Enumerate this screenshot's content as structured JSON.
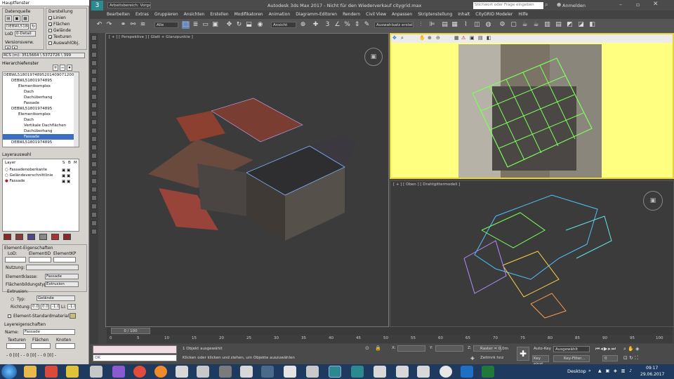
{
  "left_panel": {
    "window_title": "Hauptfenster",
    "datenquelle": {
      "label": "Datenquelle",
      "id_value": "DEBWL51801",
      "lod_label": "LoD",
      "lod_value": "0-Detail",
      "version_label": "Versionsverw."
    },
    "darstellung": {
      "label": "Darstellung",
      "items": [
        {
          "label": "Linien",
          "checked": true
        },
        {
          "label": "Flächen",
          "checked": true
        },
        {
          "label": "Gelände",
          "checked": false
        },
        {
          "label": "Texturen",
          "checked": true
        },
        {
          "label": "AuswahlObj.",
          "checked": false
        }
      ]
    },
    "rcs": "RCS (m): 3515664 \\ 5372726 \\ 399",
    "hierarchy_title": "Hierarchiefenster",
    "tree": [
      {
        "text": "DEBWL51801974895201409071200002",
        "indent": 0
      },
      {
        "text": "DEBWL51801974895",
        "indent": 1
      },
      {
        "text": "Elementkomplex",
        "indent": 2
      },
      {
        "text": "Dach",
        "indent": 3
      },
      {
        "text": "Dachüberhang",
        "indent": 3
      },
      {
        "text": "Fassade",
        "indent": 3
      },
      {
        "text": "DEBWL51801974895",
        "indent": 1
      },
      {
        "text": "Elementkomplex",
        "indent": 2
      },
      {
        "text": "Dach",
        "indent": 3
      },
      {
        "text": "Vertikale Dachflächen",
        "indent": 3
      },
      {
        "text": "Dachüberhang",
        "indent": 3
      },
      {
        "text": "Fassade",
        "indent": 3
      },
      {
        "text": "DEBWL51801974895",
        "indent": 1
      }
    ],
    "layer_title": "Layerauswahl",
    "layer_header": {
      "layer": "Layer",
      "s": "S",
      "b": "B",
      "m": "M"
    },
    "layers": [
      {
        "name": "Fassadenoberkante"
      },
      {
        "name": "Geländeverschnittlinie"
      },
      {
        "name": "Fassade"
      }
    ],
    "props_title": "Element-Eigenschaften",
    "lod_h": "LoD:",
    "elementid_h": "ElementID",
    "elementkp_h": "ElementKP",
    "nutzung_label": "Nutzung:",
    "klasse_label": "Elementklasse:",
    "klasse_value": "Fassade",
    "fb_label": "Flächenbildungstyp:",
    "fb_value": "Extrusion",
    "extr_label": "Extrusion:",
    "typ_label": "Typ:",
    "typ_value": "Gelände",
    "richtung_label": "Richtung:",
    "richtung_values": [
      "0.00",
      "0.00",
      "-1.00"
    ],
    "li_label": "Li:",
    "li_value": "-1.00",
    "std_material_label": "Element-Standardmaterial",
    "layer_props_title": "Layereigenschaften",
    "name_label": "Name:",
    "name_value": "Fassade",
    "tex_h": "Texturen",
    "fl_h": "Flächen",
    "kn_h": "Knoten",
    "bottom_nums": "- 0 [0] -  - 0 [0] -  - 0 [0] -"
  },
  "max": {
    "workspace": "Arbeitsbereich: Vorga",
    "title": "Autodesk 3ds Max 2017  -  Nicht für den Wiederverkauf    citygrid.max",
    "search_placeholder": "Stichwort oder Frage eingeben",
    "signin": "Anmelden",
    "menu": [
      "Bearbeiten",
      "Extras",
      "Gruppieren",
      "Ansichten",
      "Erstellen",
      "Modifikatoren",
      "Animation",
      "Diagramm-Editoren",
      "Rendern",
      "Civil View",
      "Anpassen",
      "Skriptenstellung",
      "Inhalt",
      "CityGRID Modeler",
      "Hilfe"
    ],
    "toolbar": {
      "filter": "Alle",
      "view": "Ansicht",
      "selset": "Auswahlsatz erstell"
    },
    "viewports": {
      "persp": "[ + ] [ Perspektive ] [ Glatt + Glanzpunkte ]",
      "top": "[ + ] [ Oben ] [ Drahtgittermodell ]"
    },
    "timeline": "0 / 100",
    "ruler": [
      "0",
      "5",
      "10",
      "15",
      "20",
      "25",
      "30",
      "35",
      "40",
      "45",
      "50",
      "55",
      "60",
      "65",
      "70",
      "75",
      "80",
      "85",
      "90",
      "95",
      "100"
    ],
    "status": {
      "selected": "1 Objekt ausgewählt",
      "hint": "Klicken oder klicken und ziehen, um Objekte auszuwählen",
      "x": "X:",
      "y": "Y:",
      "z": "Z:",
      "raster": "Raster = 0,0m",
      "zeitmarke": "Zeitmrk hnz",
      "autokey": "Auto-Key",
      "ausgewaehlt": "Ausgewählt",
      "keyset": "Key einst.",
      "keyfilter": "Key-Filter...",
      "listener": "OK",
      "frame": "0"
    }
  },
  "taskbar": {
    "desktop": "Desktop",
    "time": "09:17",
    "date": "29.06.2017"
  },
  "colors": {
    "max_bg": "#444444",
    "viewport_bg": "#3b3b3b",
    "top_vp_bg": "#ffff80",
    "panel_bg": "#d6d3ce",
    "taskbar": "#1e3a5e",
    "accent": "#4f9ad8"
  }
}
